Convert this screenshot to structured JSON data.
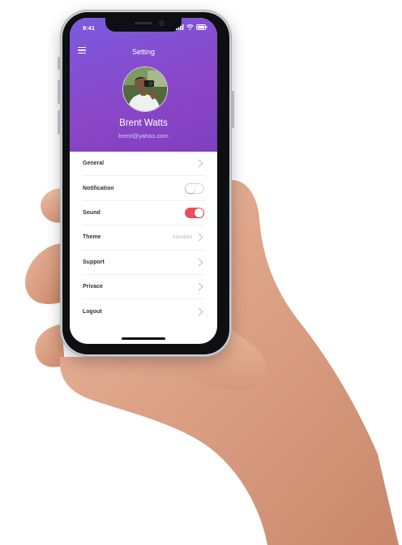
{
  "status_bar": {
    "time": "9:41"
  },
  "header": {
    "title": "Setting",
    "user_name": "Brent Watts",
    "user_email": "brent@yahoo.com",
    "gradient_start": "#7a5be0",
    "gradient_end": "#7f3fc0"
  },
  "settings": {
    "general": {
      "label": "General"
    },
    "notification": {
      "label": "Notification",
      "enabled": false
    },
    "sound": {
      "label": "Sound",
      "enabled": true
    },
    "theme": {
      "label": "Theme",
      "value": "Standard"
    },
    "support": {
      "label": "Support"
    },
    "privace": {
      "label": "Privace"
    },
    "logout": {
      "label": "Logout"
    }
  },
  "colors": {
    "toggle_on": "#ef4d5c",
    "toggle_off_border": "#cfd2d8"
  },
  "icons": [
    "menu-icon",
    "signal-icon",
    "wifi-icon",
    "battery-icon",
    "chevron-right-icon"
  ]
}
